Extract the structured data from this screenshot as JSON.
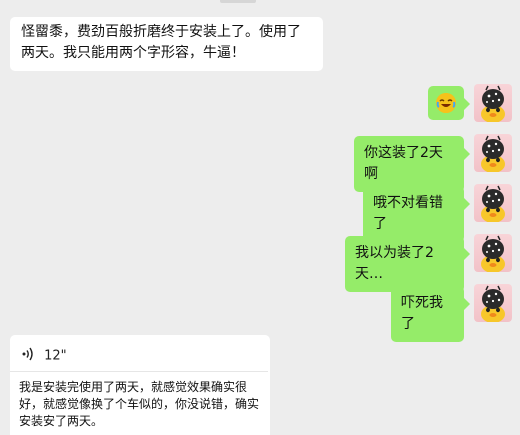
{
  "messages": [
    {
      "side": "in",
      "type": "text",
      "text": "怪罶黍，费劲百般折磨终于安装上了。使用了两天。我只能用两个字形容，牛逼！"
    },
    {
      "side": "out",
      "type": "emoji",
      "emoji": "laughing-crying-face"
    },
    {
      "side": "out",
      "type": "text",
      "text": "你这装了2天啊"
    },
    {
      "side": "out",
      "type": "text",
      "text": "哦不对看错了"
    },
    {
      "side": "out",
      "type": "text",
      "text": "我以为装了2天…"
    },
    {
      "side": "out",
      "type": "text",
      "text": "吓死我了"
    },
    {
      "side": "in",
      "type": "voice",
      "duration": "12\"",
      "transcript": "我是安装完使用了两天，就感觉效果确实很好，就感觉像换了个车似的，你没说错，确实安装安了两天。"
    }
  ],
  "colors": {
    "background": "#ededed",
    "outgoing": "#95ec69",
    "incoming": "#ffffff"
  }
}
